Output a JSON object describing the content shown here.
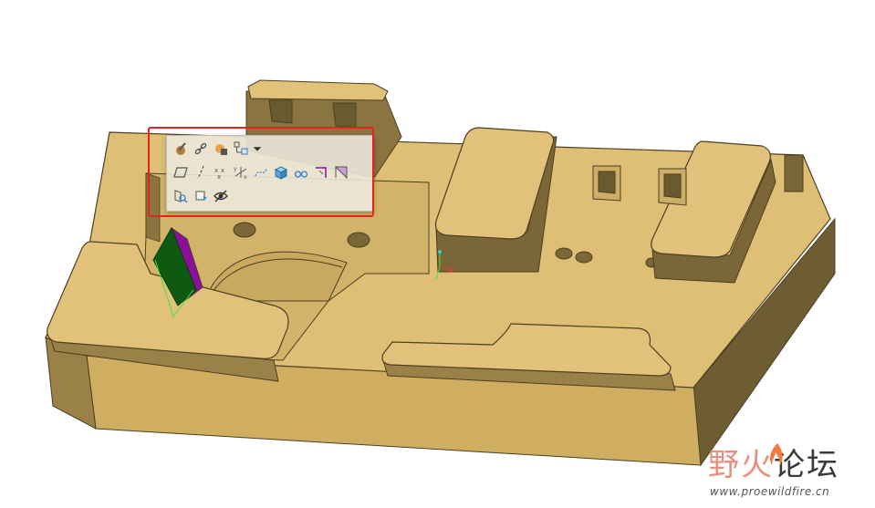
{
  "viewport": {
    "background": "#ffffff",
    "model": {
      "face_color": "#dfbf75",
      "side_color": "#8a7440",
      "dark_side_color": "#6a5a30",
      "edge_color": "#4d3f20",
      "selected_surface_color": "#0f5a12",
      "selected_side_color": "#8a0f9c",
      "datum_axis_color": "#41e33b"
    }
  },
  "mini_toolbar": {
    "highlight_color": "#e5221b",
    "rows": [
      [
        {
          "icon": "paint-brush-icon"
        },
        {
          "icon": "chain-link-icon"
        },
        {
          "icon": "appearance-sphere-icon"
        },
        {
          "icon": "datum-display-filter-icon"
        },
        {
          "icon": "dropdown-arrow-icon"
        }
      ],
      [
        {
          "icon": "datum-plane-icon"
        },
        {
          "icon": "datum-axis-icon"
        },
        {
          "icon": "datum-point-icon"
        },
        {
          "icon": "coordinate-system-icon"
        },
        {
          "icon": "sketch-curve-icon"
        },
        {
          "icon": "solid-box-icon"
        },
        {
          "icon": "glasses-icon"
        },
        {
          "icon": "sketch-corner-icon"
        },
        {
          "icon": "triangle-surface-icon"
        }
      ],
      [
        {
          "icon": "zoom-fit-icon"
        },
        {
          "icon": "reorient-icon"
        },
        {
          "icon": "hide-eye-icon"
        }
      ]
    ]
  },
  "watermark": {
    "title_part1": "野火",
    "title_part2": "论坛",
    "url": "www.proewildfire.cn",
    "flame_color": "#f07a3e"
  }
}
